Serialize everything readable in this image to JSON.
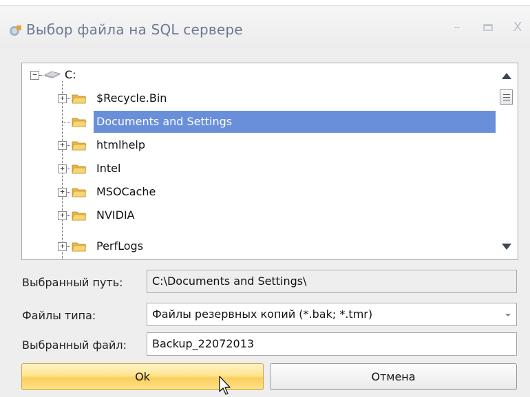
{
  "window": {
    "title": "Выбор файла на SQL сервере",
    "minimize_icon": "minimize-icon",
    "maximize_icon": "maximize-icon",
    "close_icon": "close-icon"
  },
  "tree": {
    "root": {
      "label": "C:",
      "icon": "drive-icon",
      "expanded": true
    },
    "items": [
      {
        "label": "$Recycle.Bin",
        "has_children": true,
        "selected": false
      },
      {
        "label": "Documents and Settings",
        "has_children": false,
        "selected": true
      },
      {
        "label": "htmlhelp",
        "has_children": true,
        "selected": false
      },
      {
        "label": "Intel",
        "has_children": true,
        "selected": false
      },
      {
        "label": "MSOCache",
        "has_children": true,
        "selected": false
      },
      {
        "label": "NVIDIA",
        "has_children": true,
        "selected": false
      },
      {
        "label": "PerfLogs",
        "has_children": true,
        "selected": false
      }
    ],
    "selection_color": "#6a8fda"
  },
  "form": {
    "path_label": "Выбранный путь:",
    "path_value": "C:\\Documents and Settings\\",
    "type_label": "Файлы типа:",
    "type_value": "Файлы резервных копий (*.bak; *.tmr)",
    "file_label": "Выбранный файл:",
    "file_value": "Backup_22072013"
  },
  "buttons": {
    "ok": "Ok",
    "cancel": "Отмена"
  },
  "colors": {
    "ok_button": "#ffe591",
    "title_text": "#6c7893",
    "folder": "#f2c14e"
  }
}
